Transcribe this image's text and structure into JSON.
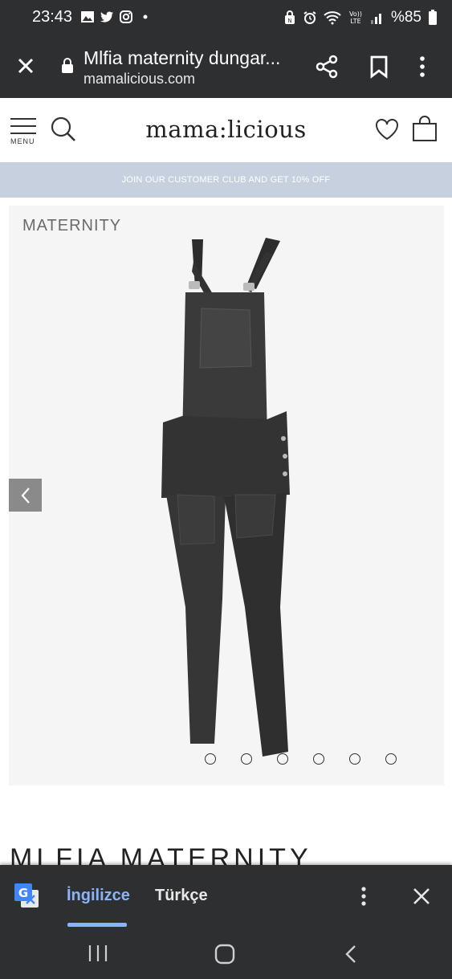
{
  "status_bar": {
    "time": "23:43",
    "battery": "%85",
    "left_icons": [
      "gallery-icon",
      "twitter-icon",
      "instagram-icon",
      "dot-icon"
    ],
    "right_icons": [
      "nfc-icon",
      "alarm-icon",
      "wifi-icon",
      "volte-icon",
      "signal-icon"
    ],
    "volte_label": "Vo)) LTE"
  },
  "browser": {
    "page_title": "Mlfia maternity dungar...",
    "domain": "mamalicious.com"
  },
  "site_header": {
    "menu_label": "MENU",
    "logo": "mama:licious"
  },
  "promo_banner": {
    "text": "JOIN OUR CUSTOMER CLUB AND GET 10% OFF"
  },
  "gallery": {
    "badge": "MATERNITY",
    "slide_count": 6,
    "active_slide": 1
  },
  "product": {
    "title_partial": "MLFIA MATERNITY"
  },
  "translate_bar": {
    "source_language": "İngilizce",
    "target_language": "Türkçe"
  },
  "colors": {
    "chrome_bg": "#2e2f31",
    "promo_bg": "#c6d0de",
    "accent_blue": "#8ab4f8"
  }
}
